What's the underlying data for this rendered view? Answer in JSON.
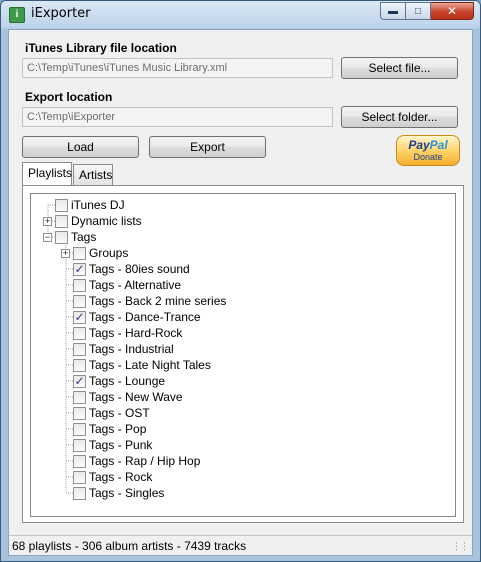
{
  "window": {
    "title": "iExporter",
    "icon": "itunes-app-icon",
    "controls": {
      "minimize": "minimize-icon",
      "maximize": "maximize-icon",
      "close": "close-icon"
    }
  },
  "library": {
    "label": "iTunes Library file location",
    "path": "C:\\Temp\\iTunes\\iTunes Music Library.xml",
    "button": "Select file..."
  },
  "export": {
    "label": "Export location",
    "path": "C:\\Temp\\iExporter",
    "button": "Select folder..."
  },
  "actions": {
    "load": "Load",
    "export": "Export"
  },
  "paypal": {
    "brand_a": "Pay",
    "brand_b": "Pal",
    "donate": "Donate"
  },
  "tabs": [
    {
      "label": "Playlists",
      "active": true
    },
    {
      "label": "Artists",
      "active": false
    }
  ],
  "tree": [
    {
      "label": "iTunes DJ",
      "level": 0,
      "expander": null,
      "checked": false
    },
    {
      "label": "Dynamic lists",
      "level": 0,
      "expander": "+",
      "checked": false
    },
    {
      "label": "Tags",
      "level": 0,
      "expander": "-",
      "checked": false
    },
    {
      "label": "Groups",
      "level": 1,
      "expander": "+",
      "checked": false
    },
    {
      "label": "Tags - 80ies sound",
      "level": 1,
      "expander": null,
      "checked": true
    },
    {
      "label": "Tags - Alternative",
      "level": 1,
      "expander": null,
      "checked": false
    },
    {
      "label": "Tags - Back 2 mine series",
      "level": 1,
      "expander": null,
      "checked": false
    },
    {
      "label": "Tags - Dance-Trance",
      "level": 1,
      "expander": null,
      "checked": true
    },
    {
      "label": "Tags - Hard-Rock",
      "level": 1,
      "expander": null,
      "checked": false
    },
    {
      "label": "Tags - Industrial",
      "level": 1,
      "expander": null,
      "checked": false
    },
    {
      "label": "Tags - Late Night Tales",
      "level": 1,
      "expander": null,
      "checked": false
    },
    {
      "label": "Tags - Lounge",
      "level": 1,
      "expander": null,
      "checked": true
    },
    {
      "label": "Tags - New Wave",
      "level": 1,
      "expander": null,
      "checked": false
    },
    {
      "label": "Tags - OST",
      "level": 1,
      "expander": null,
      "checked": false
    },
    {
      "label": "Tags - Pop",
      "level": 1,
      "expander": null,
      "checked": false
    },
    {
      "label": "Tags - Punk",
      "level": 1,
      "expander": null,
      "checked": false
    },
    {
      "label": "Tags - Rap / Hip Hop",
      "level": 1,
      "expander": null,
      "checked": false
    },
    {
      "label": "Tags - Rock",
      "level": 1,
      "expander": null,
      "checked": false
    },
    {
      "label": "Tags - Singles",
      "level": 1,
      "expander": null,
      "checked": false
    }
  ],
  "status": {
    "text": "68 playlists - 306 album artists - 7439 tracks"
  }
}
